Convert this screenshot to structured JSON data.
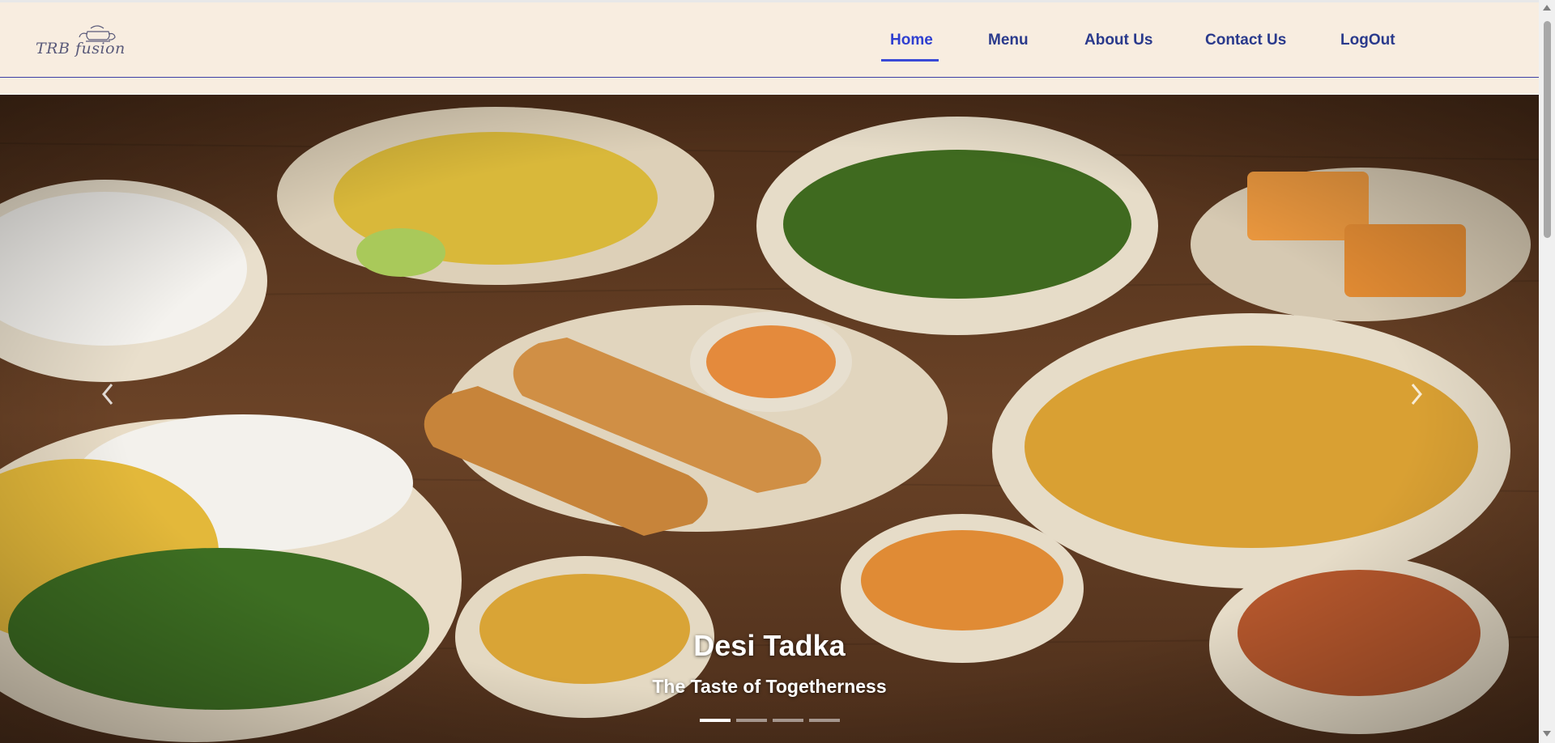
{
  "header": {
    "logo_text": "TRB fusion",
    "nav": [
      {
        "label": "Home",
        "active": true
      },
      {
        "label": "Menu",
        "active": false
      },
      {
        "label": "About Us",
        "active": false
      },
      {
        "label": "Contact Us",
        "active": false
      },
      {
        "label": "LogOut",
        "active": false
      }
    ]
  },
  "hero": {
    "title": "Desi Tadka",
    "subtitle": "The Taste of Togetherness",
    "slide_count": 4,
    "active_slide": 1
  },
  "colors": {
    "header_bg": "#f8ede0",
    "nav_text": "#2a3a8c",
    "nav_active": "#2f3fd0",
    "table_wood": "#5a3a22"
  },
  "icons": {
    "prev": "chevron-left-icon",
    "next": "chevron-right-icon",
    "logo": "teapot-logo-icon"
  }
}
